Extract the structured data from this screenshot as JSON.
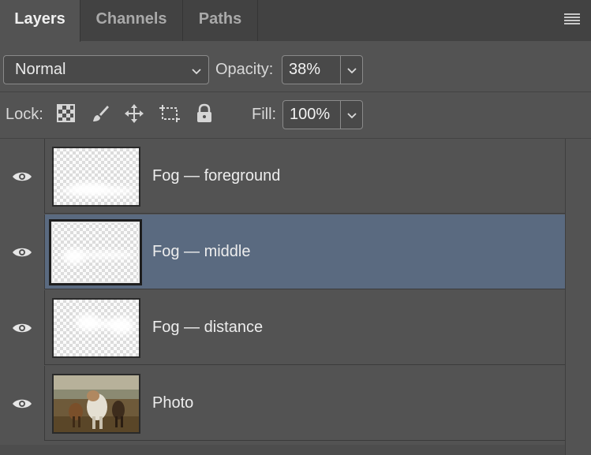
{
  "tabs": [
    {
      "label": "Layers",
      "active": true
    },
    {
      "label": "Channels",
      "active": false
    },
    {
      "label": "Paths",
      "active": false
    }
  ],
  "blend_mode": {
    "value": "Normal"
  },
  "opacity": {
    "label": "Opacity:",
    "value": "38%"
  },
  "lock": {
    "label": "Lock:",
    "icons": [
      "lock-transparent-pixels-icon",
      "lock-image-pixels-icon",
      "lock-position-icon",
      "lock-artboard-icon",
      "lock-all-icon"
    ]
  },
  "fill": {
    "label": "Fill:",
    "value": "100%"
  },
  "layers": [
    {
      "name": "Fog — foreground",
      "visible": true,
      "selected": false
    },
    {
      "name": "Fog — middle",
      "visible": true,
      "selected": true
    },
    {
      "name": "Fog — distance",
      "visible": true,
      "selected": false
    },
    {
      "name": "Photo",
      "visible": true,
      "selected": false
    }
  ],
  "colors": {
    "panel": "#535353",
    "tabbar": "#424242",
    "selected_row": "#5a6a80"
  }
}
